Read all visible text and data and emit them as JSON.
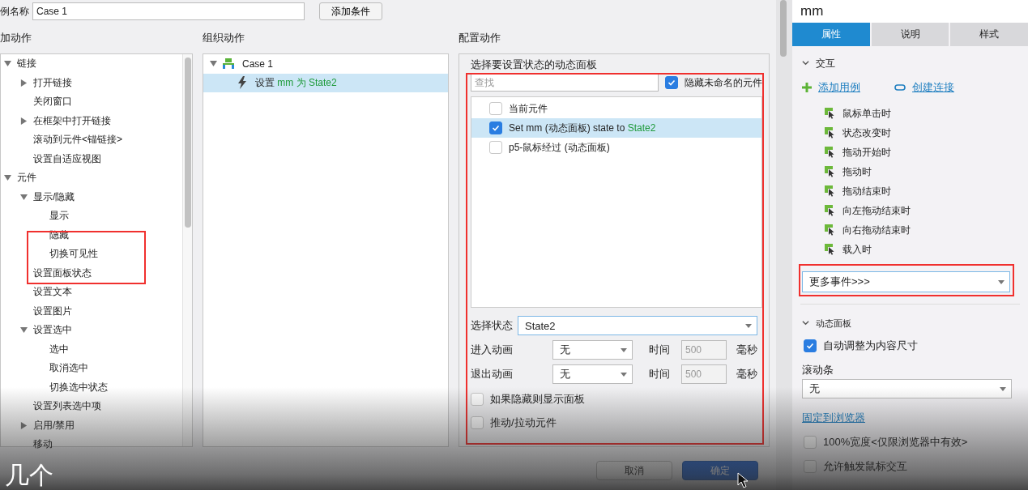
{
  "case_name": {
    "label": "例名称",
    "value": "Case 1"
  },
  "add_condition_button": "添加条件",
  "add_actions": {
    "title": "加动作",
    "tree": [
      {
        "label": "链接",
        "expanded": true,
        "children": [
          {
            "label": "打开链接",
            "expanded": false
          },
          {
            "label": "关闭窗口"
          },
          {
            "label": "在框架中打开链接",
            "expanded": false
          },
          {
            "label": "滚动到元件<锚链接>"
          },
          {
            "label": "设置自适应视图"
          }
        ]
      },
      {
        "label": "元件",
        "expanded": true,
        "children": [
          {
            "label": "显示/隐藏",
            "expanded": true,
            "children": [
              {
                "label": "显示"
              },
              {
                "label": "隐藏"
              },
              {
                "label": "切换可见性"
              }
            ]
          },
          {
            "label": "设置面板状态"
          },
          {
            "label": "设置文本"
          },
          {
            "label": "设置图片"
          },
          {
            "label": "设置选中",
            "expanded": true,
            "children": [
              {
                "label": "选中"
              },
              {
                "label": "取消选中"
              },
              {
                "label": "切换选中状态"
              }
            ]
          },
          {
            "label": "设置列表选中项"
          },
          {
            "label": "启用/禁用",
            "expanded": false
          },
          {
            "label": "移动"
          }
        ]
      }
    ]
  },
  "organize_actions": {
    "title": "组织动作",
    "tree": [
      {
        "label": "Case 1",
        "expanded": true,
        "children": [
          {
            "verb": "设置",
            "target": "mm 为 State2",
            "selected": true
          }
        ]
      }
    ]
  },
  "configure_actions": {
    "title": "配置动作",
    "panel_title": "选择要设置状态的动态面板",
    "search": {
      "placeholder": "查找"
    },
    "hide_unnamed": {
      "label": "隐藏未命名的元件",
      "checked": true
    },
    "targets": [
      {
        "label": "当前元件",
        "checked": false,
        "selected": false
      },
      {
        "label": "Set mm (动态面板) state to",
        "state": "State2",
        "checked": true,
        "selected": true
      },
      {
        "label": "p5-鼠标经过 (动态面板)",
        "checked": false,
        "selected": false
      }
    ],
    "select_state": {
      "label": "选择状态",
      "value": "State2"
    },
    "animations": [
      {
        "label": "进入动画",
        "value": "无",
        "time_label": "时间",
        "time": "500",
        "unit": "毫秒"
      },
      {
        "label": "退出动画",
        "value": "无",
        "time_label": "时间",
        "time": "500",
        "unit": "毫秒"
      }
    ],
    "options": [
      {
        "label": "如果隐藏则显示面板",
        "checked": false
      },
      {
        "label": "推动/拉动元件",
        "checked": false
      }
    ]
  },
  "buttons": [
    {
      "label": "取消",
      "kind": "secondary"
    },
    {
      "label": "确定",
      "kind": "primary"
    }
  ],
  "inspector": {
    "name": "mm",
    "tabs": [
      {
        "label": "属性",
        "selected": true
      },
      {
        "label": "说明",
        "selected": false
      },
      {
        "label": "样式",
        "selected": false
      }
    ],
    "interaction": {
      "title": "交互",
      "expanded": true,
      "add_case": "添加用例",
      "create_link": "创建连接",
      "events": [
        "鼠标单击时",
        "状态改变时",
        "拖动开始时",
        "拖动时",
        "拖动结束时",
        "向左拖动结束时",
        "向右拖动结束时",
        "载入时"
      ],
      "more_events": "更多事件>>>"
    },
    "dynamic_panel": {
      "title": "动态面板",
      "expanded": true,
      "fit_to_content": {
        "label": "自动调整为内容尺寸",
        "checked": true
      },
      "scrollbar": {
        "label": "滚动条",
        "value": "无"
      },
      "pin_link": "固定到浏览器",
      "options": [
        {
          "label": "100%宽度<仅限浏览器中有效>",
          "checked": false
        },
        {
          "label": "允许触发鼠标交互",
          "checked": false
        }
      ]
    }
  },
  "subtitle": "几个"
}
